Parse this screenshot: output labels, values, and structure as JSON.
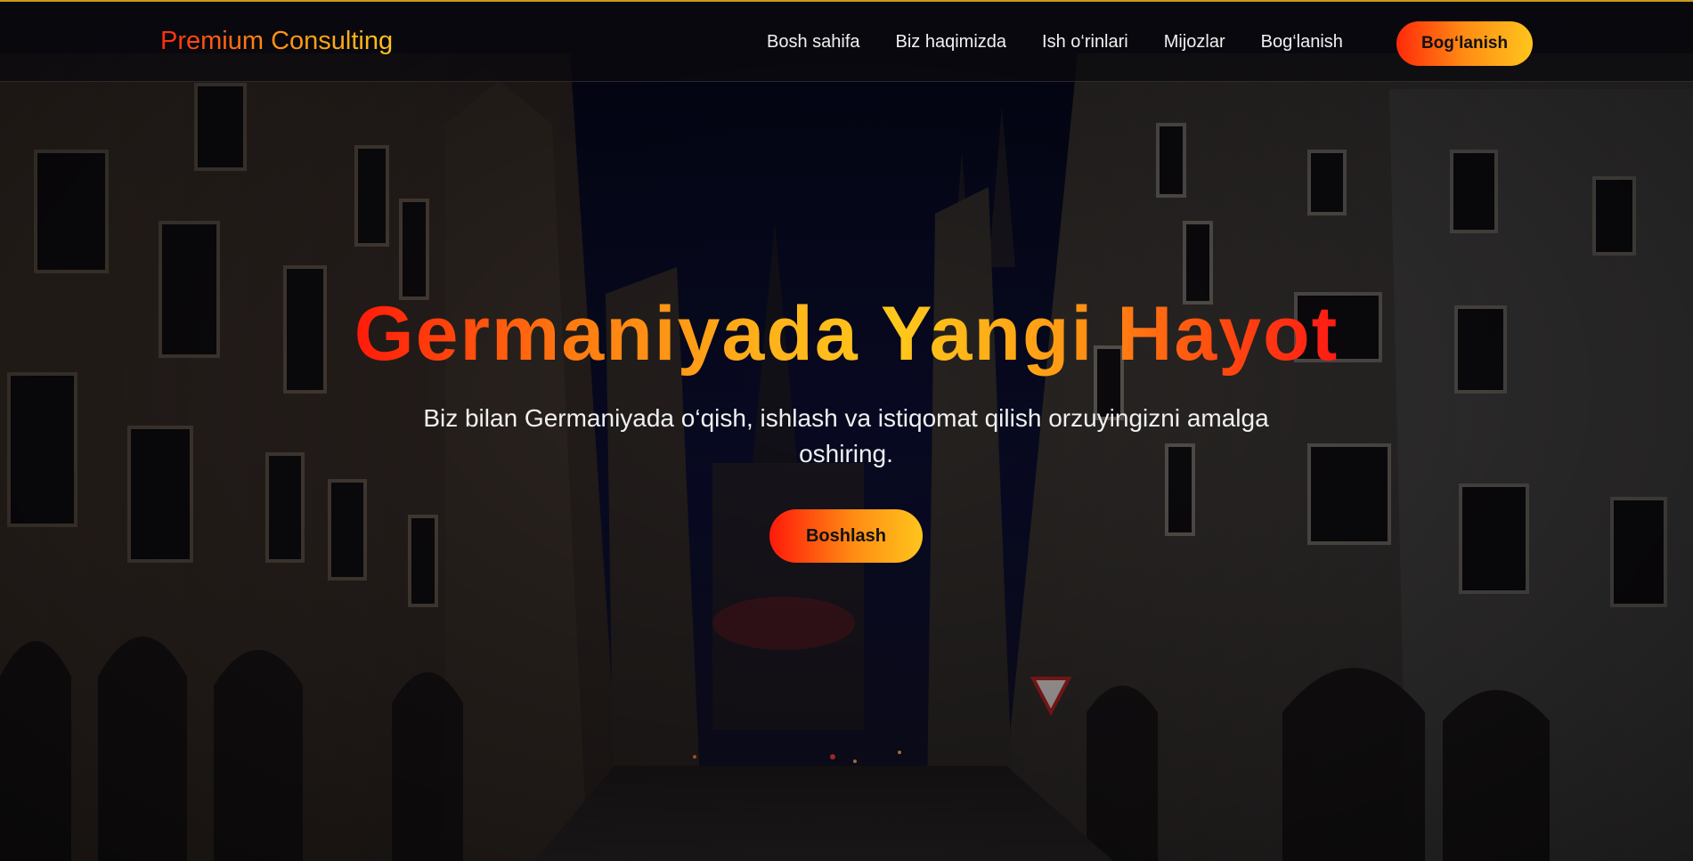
{
  "header": {
    "logo": "Premium Consulting",
    "nav": [
      {
        "label": "Bosh sahifa"
      },
      {
        "label": "Biz haqimizda"
      },
      {
        "label": "Ish o‘rinlari"
      },
      {
        "label": "Mijozlar"
      },
      {
        "label": "Bog‘lanish"
      }
    ],
    "cta_label": "Bog‘lanish"
  },
  "hero": {
    "title": "Germaniyada Yangi Hayot",
    "subtitle": "Biz bilan Germaniyada o‘qish, ishlash va istiqomat qilish orzuyingizni amalga oshiring.",
    "cta_label": "Boshlash"
  },
  "colors": {
    "accent_start": "#ff1a0a",
    "accent_mid": "#ff8c14",
    "accent_end": "#ffc51c",
    "header_bg": "#0c0a0e",
    "header_border_top": "#c99a1a"
  }
}
